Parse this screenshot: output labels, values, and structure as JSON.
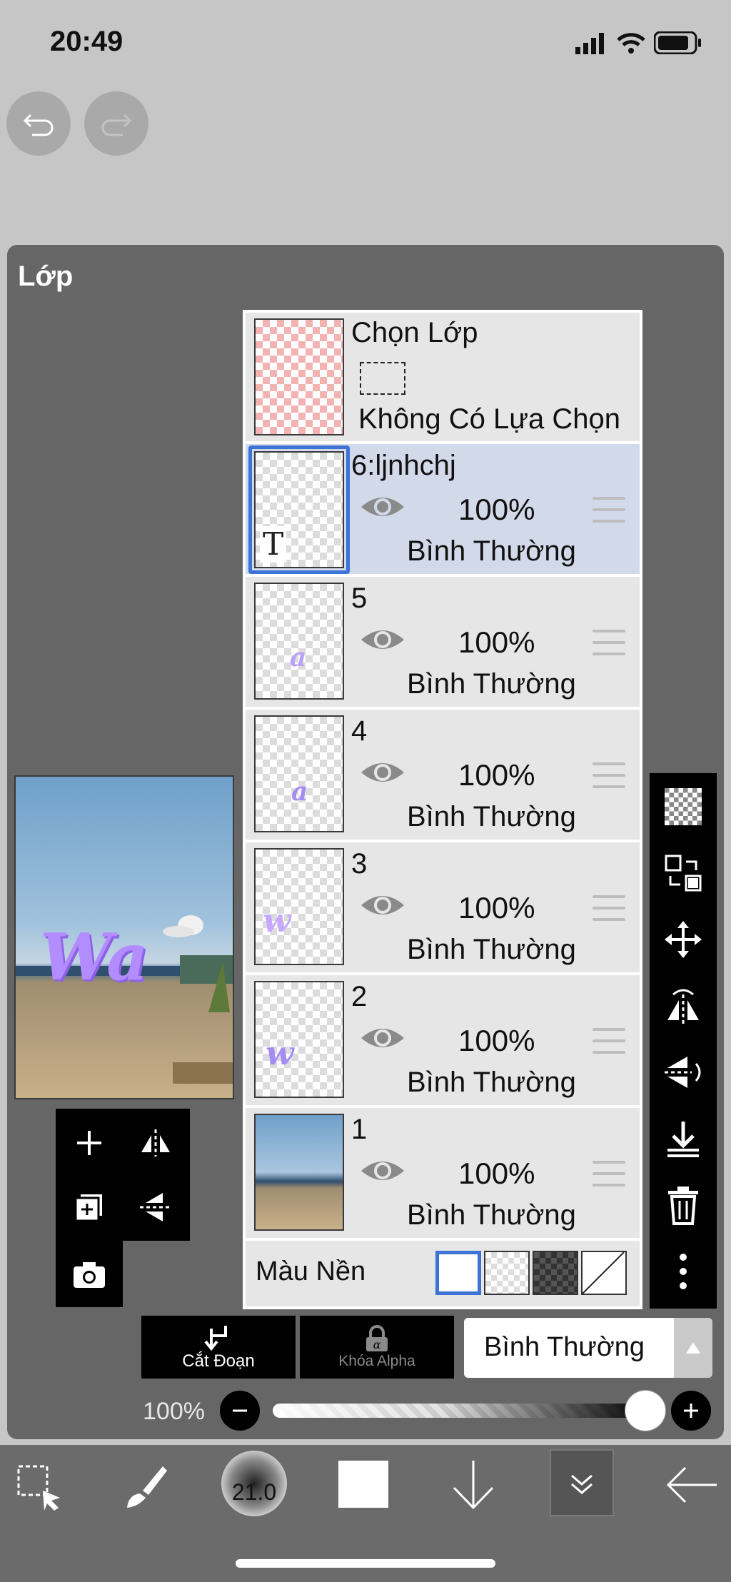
{
  "status": {
    "time": "20:49"
  },
  "panel": {
    "title": "Lớp"
  },
  "selection_layer": {
    "title": "Chọn Lớp",
    "subtitle": "Không Có Lựa Chọn"
  },
  "layers": [
    {
      "name": "6:ljnhchj",
      "opacity": "100%",
      "blend": "Bình Thường",
      "active": true,
      "thumb_glyph": "T"
    },
    {
      "name": "5",
      "opacity": "100%",
      "blend": "Bình Thường",
      "thumb_glyph": "a"
    },
    {
      "name": "4",
      "opacity": "100%",
      "blend": "Bình Thường",
      "thumb_glyph": "a"
    },
    {
      "name": "3",
      "opacity": "100%",
      "blend": "Bình Thường",
      "thumb_glyph": "w"
    },
    {
      "name": "2",
      "opacity": "100%",
      "blend": "Bình Thường",
      "thumb_glyph": "w"
    },
    {
      "name": "1",
      "opacity": "100%",
      "blend": "Bình Thường",
      "thumb_glyph": "photo"
    }
  ],
  "background": {
    "label": "Màu Nền"
  },
  "canvas_preview": {
    "text": "Wa"
  },
  "actions": {
    "clipping": "Cắt Đoạn",
    "alpha_lock": "Khóa Alpha",
    "blend_mode": "Bình Thường"
  },
  "opacity_slider": {
    "label": "100%",
    "value": 1.0
  },
  "toolbar": {
    "brush_size": "21.0"
  },
  "colors": {
    "accent": "#3d73d6",
    "purple": "#b38cff",
    "panel": "#666666"
  }
}
